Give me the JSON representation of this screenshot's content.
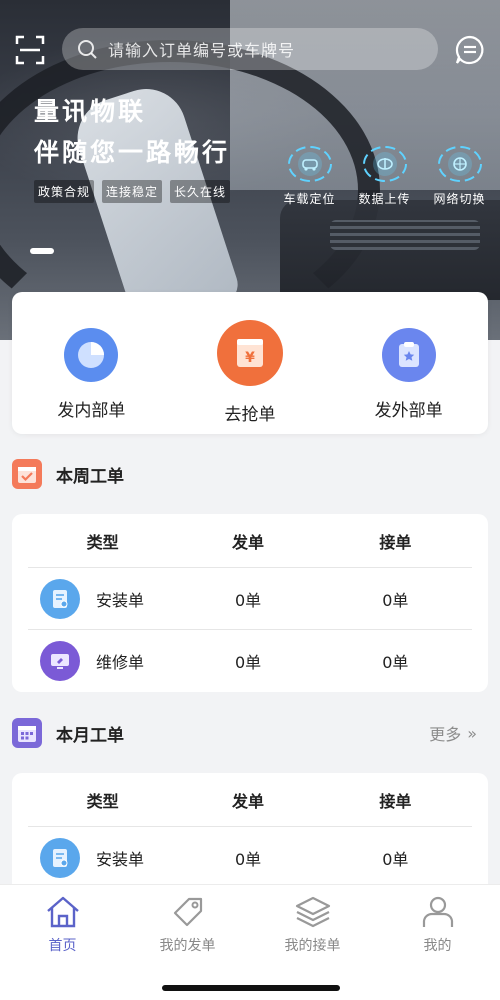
{
  "search": {
    "placeholder": "请输入订单编号或车牌号"
  },
  "banner": {
    "slogan_line1": "量讯物联",
    "slogan_line2": "伴随您一路畅行",
    "tags": [
      "政策合规",
      "连接稳定",
      "长久在线"
    ],
    "features": [
      {
        "label": "车载定位",
        "icon": "car-location-icon"
      },
      {
        "label": "数据上传",
        "icon": "data-upload-icon"
      },
      {
        "label": "网络切换",
        "icon": "network-switch-icon"
      }
    ]
  },
  "quick_actions": [
    {
      "label": "发内部单",
      "icon": "pie-chart-icon",
      "color": "#5b8def"
    },
    {
      "label": "去抢单",
      "icon": "yuan-box-icon",
      "color": "#f0703c"
    },
    {
      "label": "发外部单",
      "icon": "clipboard-star-icon",
      "color": "#6a86ee"
    }
  ],
  "weekly": {
    "title": "本周工单",
    "icon_color": "#f47a5a",
    "columns": [
      "类型",
      "发单",
      "接单"
    ],
    "rows": [
      {
        "name": "安装单",
        "send": "0单",
        "recv": "0单",
        "icon": "install-doc-icon",
        "color": "#5aa7ec"
      },
      {
        "name": "维修单",
        "send": "0单",
        "recv": "0单",
        "icon": "repair-monitor-icon",
        "color": "#7b5ad6"
      }
    ]
  },
  "monthly": {
    "title": "本月工单",
    "more": "更多",
    "icon_color": "#7b68d8",
    "columns": [
      "类型",
      "发单",
      "接单"
    ],
    "rows": [
      {
        "name": "安装单",
        "send": "0单",
        "recv": "0单",
        "icon": "install-doc-icon",
        "color": "#5aa7ec"
      }
    ]
  },
  "tabbar": {
    "items": [
      {
        "label": "首页",
        "icon": "home-icon",
        "active": true
      },
      {
        "label": "我的发单",
        "icon": "tag-icon",
        "active": false
      },
      {
        "label": "我的接单",
        "icon": "layers-icon",
        "active": false
      },
      {
        "label": "我的",
        "icon": "user-icon",
        "active": false
      }
    ],
    "active_color": "#5b63c9"
  }
}
